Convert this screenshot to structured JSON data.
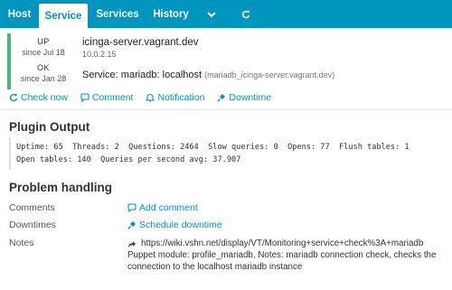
{
  "tabs": [
    {
      "label": "Host"
    },
    {
      "label": "Service"
    },
    {
      "label": "Services"
    },
    {
      "label": "History"
    }
  ],
  "icons": {
    "more": "chevron-down-icon",
    "refresh": "refresh-icon"
  },
  "colors": {
    "accent": "#0095bf",
    "ok": "#44bb77"
  },
  "host": {
    "state": "UP",
    "since": "since Jul 18",
    "name": "icinga-server.vagrant.dev",
    "address": "10.0.2.15"
  },
  "service": {
    "state": "OK",
    "since": "since Jan 28",
    "label": "Service: mariadb: localhost",
    "full_name": "(mariadb_icinga-server.vagrant.dev)"
  },
  "actions": {
    "check_now": "Check now",
    "comment": "Comment",
    "notification": "Notification",
    "downtime": "Downtime"
  },
  "plugin_output": {
    "title": "Plugin Output",
    "line1": "Uptime: 65  Threads: 2  Questions: 2464  Slow queries: 0  Opens: 77  Flush tables: 1",
    "line2": "Open tables: 140  Queries per second avg: 37.907"
  },
  "problem_handling": {
    "title": "Problem handling",
    "comments_label": "Comments",
    "add_comment": "Add comment",
    "downtimes_label": "Downtimes",
    "schedule_downtime": "Schedule downtime",
    "notes_label": "Notes",
    "notes_url": "https://wiki.vshn.net/display/VT/Monitoring+service+check%3A+mariadb",
    "notes_text": "Puppet module: profile_mariadb, Notes: mariadb connection check, checks the connection to the localhost mariadb instance"
  }
}
